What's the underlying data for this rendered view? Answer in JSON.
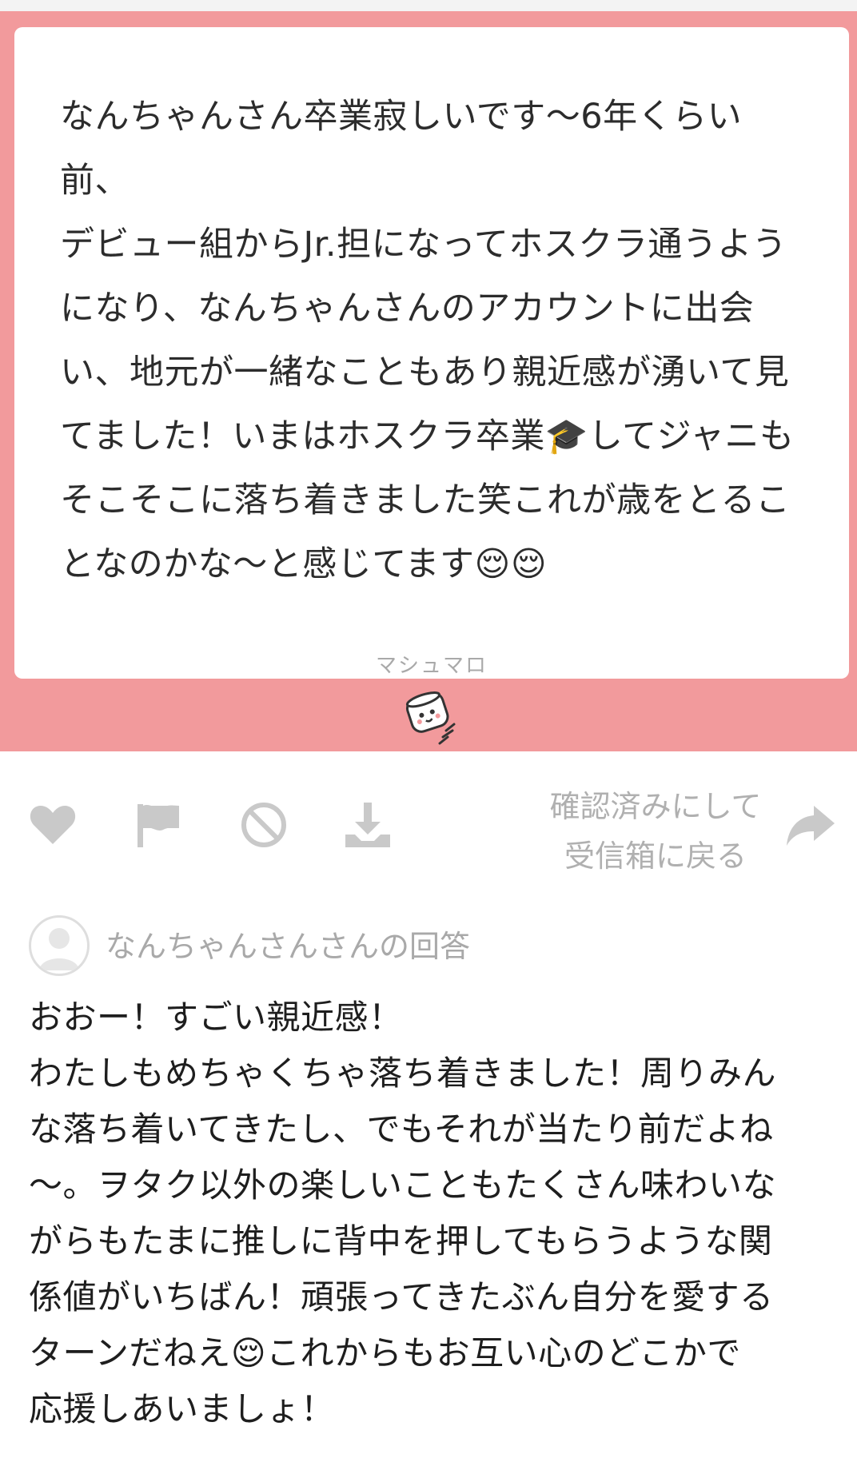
{
  "question": {
    "lines": [
      "なんちゃんさん卒業寂しいです〜6年くらい前、",
      "デビュー組からJr.担になってホスクラ通うよう",
      "になり、なんちゃんさんのアカウントに出会",
      "い、地元が一緒なこともあり親近感が湧いて見",
      "てました！いまはホスクラ卒業🎓してジャニも",
      "そこそこに落ち着きました笑これが歳をとるこ",
      "となのかな〜と感じてます😌😌"
    ],
    "footer": "マシュマロ"
  },
  "actions": {
    "like_icon": "heart-icon",
    "flag_icon": "flag-icon",
    "block_icon": "block-icon",
    "download_icon": "download-icon",
    "confirm_line1": "確認済みにして",
    "confirm_line2": "受信箱に戻る",
    "return_icon": "share-arrow-icon"
  },
  "answer": {
    "title": "なんちゃんさんさんの回答",
    "lines": [
      "おおー！すごい親近感！",
      "わたしもめちゃくちゃ落ち着きました！周りみん",
      "な落ち着いてきたし、でもそれが当たり前だよね",
      "〜。ヲタク以外の楽しいこともたくさん味わいな",
      "がらもたまに推しに背中を押してもらうような関",
      "係値がいちばん！頑張ってきたぶん自分を愛する",
      "ターンだねえ😌これからもお互い心のどこかで",
      "応援しあいましょ！"
    ]
  },
  "colors": {
    "band": "#f29a9c",
    "icon_gray": "#c9c9c9",
    "text_gray": "#a9a9a9"
  }
}
